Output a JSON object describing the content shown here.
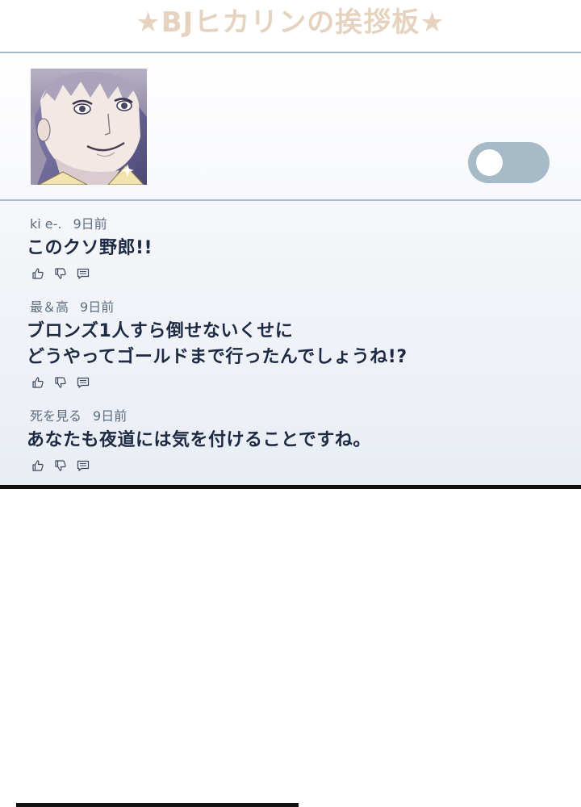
{
  "title": "★BJヒカリンの挨拶板★",
  "comments": [
    {
      "author": "ki e-.",
      "time": "9日前",
      "lines": [
        "このクソ野郎!!"
      ]
    },
    {
      "author": "最＆高",
      "time": "9日前",
      "lines": [
        "ブロンズ1人すら倒せないくせに",
        "どうやってゴールドまで行ったんでしょうね!?"
      ]
    },
    {
      "author": "死を見る",
      "time": "9日前",
      "lines": [
        "あなたも夜道には気を付けることですね。"
      ]
    }
  ],
  "colors": {
    "title": "#e6d3bf",
    "toggle": "#a7bac7",
    "divider": "#a9bccb",
    "text": "#1d2a44",
    "meta": "#5e6e80"
  },
  "icons": {
    "like": "thumbs-up-icon",
    "dislike": "thumbs-down-icon",
    "reply": "comment-icon"
  }
}
